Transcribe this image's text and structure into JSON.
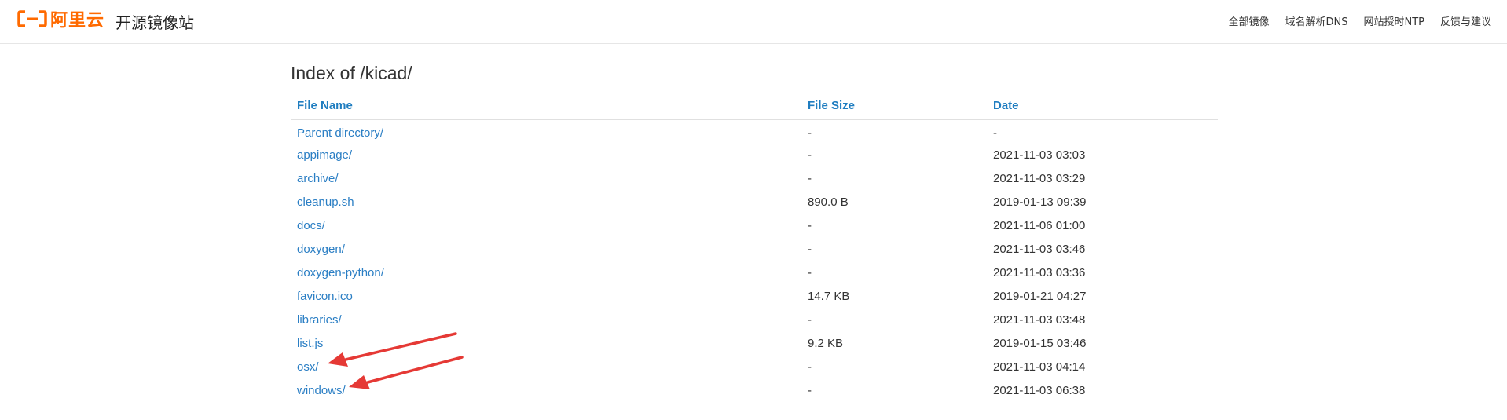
{
  "header": {
    "logo_text": "阿里云",
    "site_name": "开源镜像站",
    "brand_color": "#ff6a00",
    "nav": [
      {
        "label": "全部镜像"
      },
      {
        "label": "域名解析DNS"
      },
      {
        "label": "网站授时NTP"
      },
      {
        "label": "反馈与建议"
      }
    ]
  },
  "main": {
    "title": "Index of /kicad/",
    "columns": [
      "File Name",
      "File Size",
      "Date"
    ],
    "rows": [
      {
        "name": "Parent directory/",
        "size": "-",
        "date": "-"
      },
      {
        "name": "appimage/",
        "size": "-",
        "date": "2021-11-03 03:03"
      },
      {
        "name": "archive/",
        "size": "-",
        "date": "2021-11-03 03:29"
      },
      {
        "name": "cleanup.sh",
        "size": "890.0 B",
        "date": "2019-01-13 09:39"
      },
      {
        "name": "docs/",
        "size": "-",
        "date": "2021-11-06 01:00"
      },
      {
        "name": "doxygen/",
        "size": "-",
        "date": "2021-11-03 03:46"
      },
      {
        "name": "doxygen-python/",
        "size": "-",
        "date": "2021-11-03 03:36"
      },
      {
        "name": "favicon.ico",
        "size": "14.7 KB",
        "date": "2019-01-21 04:27"
      },
      {
        "name": "libraries/",
        "size": "-",
        "date": "2021-11-03 03:48"
      },
      {
        "name": "list.js",
        "size": "9.2 KB",
        "date": "2019-01-15 03:46"
      },
      {
        "name": "osx/",
        "size": "-",
        "date": "2021-11-03 04:14"
      },
      {
        "name": "windows/",
        "size": "-",
        "date": "2021-11-03 06:38"
      }
    ]
  },
  "annotations": {
    "arrow_color": "#e53935",
    "icon_name": "red-arrow-icon"
  }
}
